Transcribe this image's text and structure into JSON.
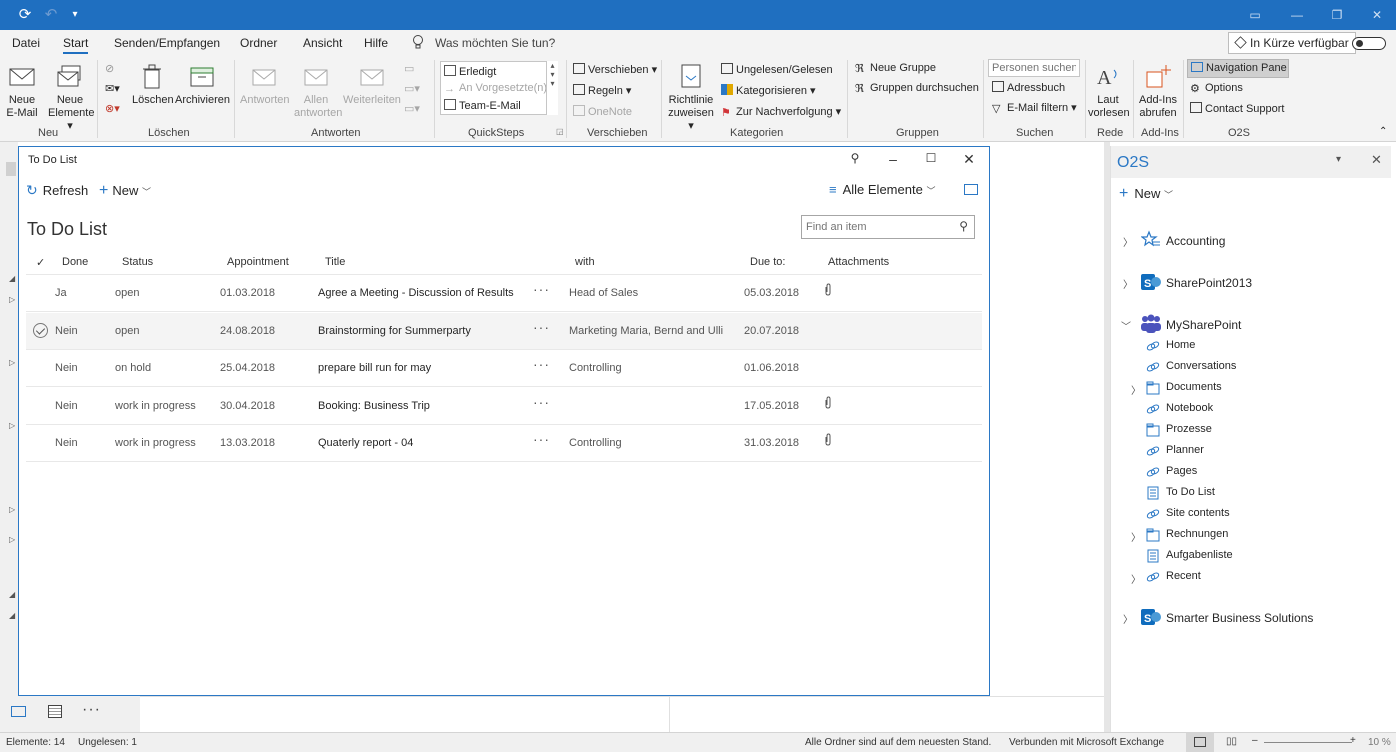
{
  "menu": {
    "tabs": [
      "Datei",
      "Start",
      "Senden/Empfangen",
      "Ordner",
      "Ansicht",
      "Hilfe"
    ],
    "active_tab": "Start",
    "tellme": "Was möchten Sie tun?",
    "soon": "In Kürze verfügbar"
  },
  "ribbon": {
    "neu": {
      "new_email": "Neue E-Mail",
      "new_email_l1": "Neue",
      "new_email_l2": "E-Mail",
      "new_items_l1": "Neue",
      "new_items_l2": "Elemente",
      "label": "Neu"
    },
    "loeschen": {
      "delete": "Löschen",
      "archive": "Archivieren",
      "label": "Löschen"
    },
    "antworten": {
      "reply": "Antworten",
      "reply_all_l1": "Allen",
      "reply_all_l2": "antworten",
      "forward": "Weiterleiten",
      "label": "Antworten"
    },
    "quicksteps": {
      "items": [
        "Erledigt",
        "An Vorgesetzte(n)",
        "Team-E-Mail"
      ],
      "label": "QuickSteps"
    },
    "verschieben": {
      "move": "Verschieben",
      "rules": "Regeln",
      "onenote": "OneNote",
      "label": "Verschieben"
    },
    "kategorien": {
      "policy_l1": "Richtlinie",
      "policy_l2": "zuweisen",
      "unread": "Ungelesen/Gelesen",
      "categorize": "Kategorisieren",
      "followup": "Zur Nachverfolgung",
      "label": "Kategorien"
    },
    "gruppen": {
      "new_group": "Neue Gruppe",
      "browse": "Gruppen durchsuchen",
      "label": "Gruppen"
    },
    "suchen": {
      "placeholder": "Personen suchen",
      "addressbook": "Adressbuch",
      "filter": "E-Mail filtern",
      "label": "Suchen"
    },
    "rede": {
      "read_l1": "Laut",
      "read_l2": "vorlesen",
      "label": "Rede"
    },
    "addins": {
      "get_l1": "Add-Ins",
      "get_l2": "abrufen",
      "label": "Add-Ins"
    },
    "o2s": {
      "navpane": "Navigation Pane",
      "options": "Options",
      "support": "Contact Support",
      "label": "O2S"
    }
  },
  "todo": {
    "window_title": "To Do List",
    "refresh": "Refresh",
    "new": "New",
    "view": "Alle Elemente",
    "heading": "To Do List",
    "search_placeholder": "Find an item",
    "columns": [
      "Done",
      "Status",
      "Appointment",
      "Title",
      "with",
      "Due to:",
      "Attachments"
    ],
    "rows": [
      {
        "done": "Ja",
        "status": "open",
        "appointment": "01.03.2018",
        "title": "Agree a Meeting - Discussion of Results",
        "with": "Head of Sales",
        "due": "05.03.2018",
        "attachment": true,
        "selected": false
      },
      {
        "done": "Nein",
        "status": "open",
        "appointment": "24.08.2018",
        "title": "Brainstorming for Summerparty",
        "with": "Marketing Maria, Bernd and Ulli",
        "due": "20.07.2018",
        "attachment": false,
        "selected": true
      },
      {
        "done": "Nein",
        "status": "on hold",
        "appointment": "25.04.2018",
        "title": "prepare bill run for may",
        "with": "Controlling",
        "due": "01.06.2018",
        "attachment": false,
        "selected": false
      },
      {
        "done": "Nein",
        "status": "work in progress",
        "appointment": "30.04.2018",
        "title": "Booking: Business Trip",
        "with": "",
        "due": "17.05.2018",
        "attachment": true,
        "selected": false
      },
      {
        "done": "Nein",
        "status": "work in progress",
        "appointment": "13.03.2018",
        "title": "Quaterly report - 04",
        "with": "Controlling",
        "due": "31.03.2018",
        "attachment": true,
        "selected": false
      }
    ]
  },
  "o2s": {
    "title": "O2S",
    "new": "New",
    "tree": {
      "accounting": "Accounting",
      "sharepoint2013": "SharePoint2013",
      "mysharepoint": "MySharePoint",
      "children": [
        "Home",
        "Conversations",
        "Documents",
        "Notebook",
        "Prozesse",
        "Planner",
        "Pages",
        "To Do List",
        "Site contents",
        "Rechnungen",
        "Aufgabenliste",
        "Recent"
      ],
      "smarter": "Smarter Business Solutions"
    }
  },
  "status": {
    "items": "Elemente: 14",
    "unread": "Ungelesen: 1",
    "uptodate": "Alle Ordner sind auf dem neuesten Stand.",
    "connected": "Verbunden mit Microsoft Exchange",
    "zoom": "10 %"
  },
  "colors": {
    "accent": "#1f6fc0",
    "titlebar": "#1f6fc0",
    "sharepoint": "#0f6cbd",
    "teams": "#4b53bc"
  }
}
